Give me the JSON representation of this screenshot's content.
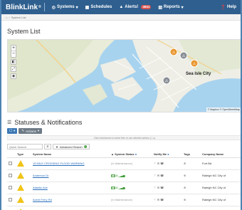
{
  "nav": {
    "brand": "BlinkLink",
    "brand_mark": "®",
    "systems": "Systems",
    "schedules": "Schedules",
    "alerts": "Alerts!",
    "alerts_count": "4841",
    "reports": "Reports",
    "help": "Help"
  },
  "breadcrumb": {
    "current": "System List"
  },
  "page": {
    "title": "System List"
  },
  "map": {
    "place_label": "Sea Isle City",
    "attribution": "© Mapbox © OpenStreetMap"
  },
  "statuses": {
    "title": "Statuses & Notifications",
    "actions_label": "Actions",
    "hint": "Click checkboxes to select then re-use selected actions (☐ ▸)",
    "search_placeholder": "Quick Search",
    "advanced_search": "Advanced Search",
    "advanced_count": "0"
  },
  "table": {
    "headers": [
      "Type",
      "System Name",
      "System Status",
      "Notify Me",
      "Tags",
      "Company Name"
    ],
    "rows": [
      {
        "name": "15 MILE CROSSING FLOOD WARNING",
        "status": "(In Maintenance)",
        "company": "Fort Bd"
      },
      {
        "name": "Anderson Dr",
        "status": "3",
        "company": "Raleigh NC City of"
      },
      {
        "name": "Atlantic Ave",
        "status": "3",
        "company": "Raleigh NC City of"
      },
      {
        "name": "Avent Ferry Rd",
        "status": "(In Maintenance)",
        "company": "Raleigh NC City of"
      }
    ]
  }
}
